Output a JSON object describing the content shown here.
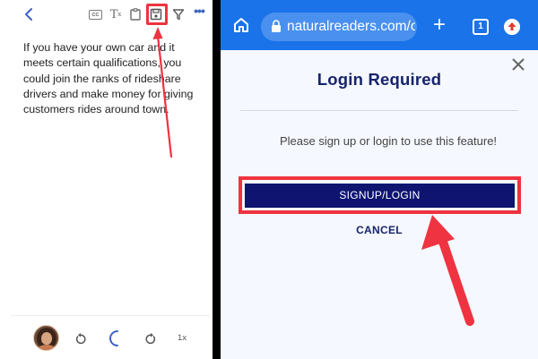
{
  "left_panel": {
    "toolbar": {
      "back_icon": "chevron-left-icon",
      "icons": [
        "cc-icon",
        "clear-format-icon",
        "clipboard-icon",
        "save-icon",
        "filter-icon",
        "more-icon"
      ],
      "more_label": "•••"
    },
    "document_text": "If you have your own car and it meets certain qualifications, you could join the ranks of rideshare drivers and make money for giving customers rides around town.",
    "player": {
      "avatar": "avatar",
      "rewind_icon": "rewind-icon",
      "loading_icon": "loading-spinner-icon",
      "forward_icon": "forward-icon",
      "speed": "1x"
    }
  },
  "browser": {
    "url": "naturalreaders.com/oi",
    "tab_count": "1",
    "icons": [
      "home-icon",
      "lock-icon",
      "plus-icon",
      "tabs-icon",
      "upload-icon"
    ]
  },
  "dialog": {
    "title": "Login Required",
    "message": "Please sign up or login to use this feature!",
    "signup_label": "SIGNUP/LOGIN",
    "cancel_label": "CANCEL",
    "close_icon": "close-icon"
  },
  "annotations": {
    "highlight_color": "#ef3340",
    "arrow_color": "#ef3340"
  },
  "colors": {
    "browser_blue": "#1a73e8",
    "dialog_navy": "#0e1470",
    "title_navy": "#17246c",
    "accent_blue": "#3c63c4"
  }
}
